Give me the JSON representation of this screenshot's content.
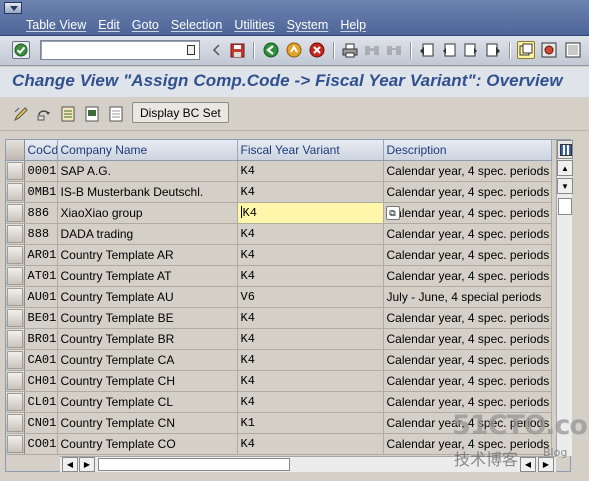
{
  "menu": {
    "items": [
      "Table View",
      "Edit",
      "Goto",
      "Selection",
      "Utilities",
      "System",
      "Help"
    ]
  },
  "toolbar": {
    "command_value": "",
    "icons": [
      "enter-icon",
      "back-icon",
      "save-icon",
      "exit-icon",
      "cancel-icon",
      "print-icon",
      "find-icon",
      "find-next-icon",
      "first-page-icon",
      "prev-page-icon",
      "next-page-icon",
      "last-page-icon",
      "create-session-icon",
      "help-icon"
    ]
  },
  "page_title": "Change View \"Assign Comp.Code -> Fiscal Year Variant\": Overview",
  "app_toolbar": {
    "display_bc_set_label": "Display BC Set"
  },
  "grid": {
    "columns": [
      "CoCd",
      "Company Name",
      "Fiscal Year Variant",
      "Description"
    ],
    "selected_row_index": 2,
    "rows": [
      {
        "cocd": "0001",
        "name": "SAP A.G.",
        "fyv": "K4",
        "desc": "Calendar year, 4 spec. periods"
      },
      {
        "cocd": "0MB1",
        "name": "IS-B Musterbank Deutschl.",
        "fyv": "K4",
        "desc": "Calendar year, 4 spec. periods"
      },
      {
        "cocd": "886",
        "name": "XiaoXiao group",
        "fyv": "K4",
        "desc": "Calendar year, 4 spec. periods"
      },
      {
        "cocd": "888",
        "name": "DADA trading",
        "fyv": "K4",
        "desc": "Calendar year, 4 spec. periods"
      },
      {
        "cocd": "AR01",
        "name": "Country Template AR",
        "fyv": "K4",
        "desc": "Calendar year, 4 spec. periods"
      },
      {
        "cocd": "AT01",
        "name": "Country Template AT",
        "fyv": "K4",
        "desc": "Calendar year, 4 spec. periods"
      },
      {
        "cocd": "AU01",
        "name": "Country Template AU",
        "fyv": "V6",
        "desc": "July - June, 4 special periods"
      },
      {
        "cocd": "BE01",
        "name": "Country Template BE",
        "fyv": "K4",
        "desc": "Calendar year, 4 spec. periods"
      },
      {
        "cocd": "BR01",
        "name": "Country Template BR",
        "fyv": "K4",
        "desc": "Calendar year, 4 spec. periods"
      },
      {
        "cocd": "CA01",
        "name": "Country Template CA",
        "fyv": "K4",
        "desc": "Calendar year, 4 spec. periods"
      },
      {
        "cocd": "CH01",
        "name": "Country Template CH",
        "fyv": "K4",
        "desc": "Calendar year, 4 spec. periods"
      },
      {
        "cocd": "CL01",
        "name": "Country Template CL",
        "fyv": "K4",
        "desc": "Calendar year, 4 spec. periods"
      },
      {
        "cocd": "CN01",
        "name": "Country Template CN",
        "fyv": "K1",
        "desc": "Calendar year, 4 spec. periods"
      },
      {
        "cocd": "CO01",
        "name": "Country Template CO",
        "fyv": "K4",
        "desc": "Calendar year, 4 spec. periods"
      }
    ]
  },
  "watermark": {
    "site": "51CTO.com",
    "tagline": "技术博客",
    "blog": "Blog"
  },
  "colors": {
    "menubar": "#4d6598",
    "title_text": "#30508f",
    "header_text": "#1e3b78",
    "selected_cell": "#fff6a9"
  }
}
